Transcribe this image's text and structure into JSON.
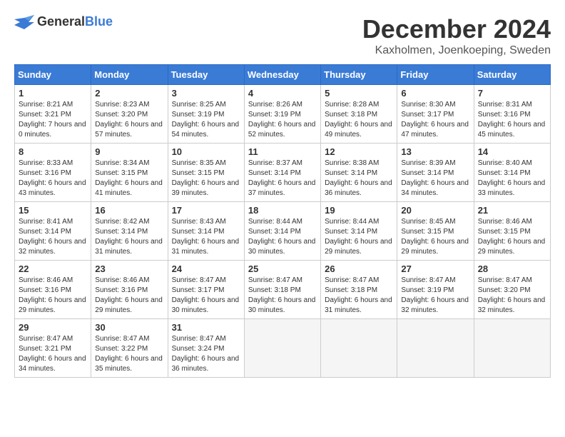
{
  "header": {
    "logo_general": "General",
    "logo_blue": "Blue",
    "title": "December 2024",
    "location": "Kaxholmen, Joenkoeping, Sweden"
  },
  "days_of_week": [
    "Sunday",
    "Monday",
    "Tuesday",
    "Wednesday",
    "Thursday",
    "Friday",
    "Saturday"
  ],
  "weeks": [
    [
      {
        "day": "1",
        "sunrise": "Sunrise: 8:21 AM",
        "sunset": "Sunset: 3:21 PM",
        "daylight": "Daylight: 7 hours and 0 minutes."
      },
      {
        "day": "2",
        "sunrise": "Sunrise: 8:23 AM",
        "sunset": "Sunset: 3:20 PM",
        "daylight": "Daylight: 6 hours and 57 minutes."
      },
      {
        "day": "3",
        "sunrise": "Sunrise: 8:25 AM",
        "sunset": "Sunset: 3:19 PM",
        "daylight": "Daylight: 6 hours and 54 minutes."
      },
      {
        "day": "4",
        "sunrise": "Sunrise: 8:26 AM",
        "sunset": "Sunset: 3:19 PM",
        "daylight": "Daylight: 6 hours and 52 minutes."
      },
      {
        "day": "5",
        "sunrise": "Sunrise: 8:28 AM",
        "sunset": "Sunset: 3:18 PM",
        "daylight": "Daylight: 6 hours and 49 minutes."
      },
      {
        "day": "6",
        "sunrise": "Sunrise: 8:30 AM",
        "sunset": "Sunset: 3:17 PM",
        "daylight": "Daylight: 6 hours and 47 minutes."
      },
      {
        "day": "7",
        "sunrise": "Sunrise: 8:31 AM",
        "sunset": "Sunset: 3:16 PM",
        "daylight": "Daylight: 6 hours and 45 minutes."
      }
    ],
    [
      {
        "day": "8",
        "sunrise": "Sunrise: 8:33 AM",
        "sunset": "Sunset: 3:16 PM",
        "daylight": "Daylight: 6 hours and 43 minutes."
      },
      {
        "day": "9",
        "sunrise": "Sunrise: 8:34 AM",
        "sunset": "Sunset: 3:15 PM",
        "daylight": "Daylight: 6 hours and 41 minutes."
      },
      {
        "day": "10",
        "sunrise": "Sunrise: 8:35 AM",
        "sunset": "Sunset: 3:15 PM",
        "daylight": "Daylight: 6 hours and 39 minutes."
      },
      {
        "day": "11",
        "sunrise": "Sunrise: 8:37 AM",
        "sunset": "Sunset: 3:14 PM",
        "daylight": "Daylight: 6 hours and 37 minutes."
      },
      {
        "day": "12",
        "sunrise": "Sunrise: 8:38 AM",
        "sunset": "Sunset: 3:14 PM",
        "daylight": "Daylight: 6 hours and 36 minutes."
      },
      {
        "day": "13",
        "sunrise": "Sunrise: 8:39 AM",
        "sunset": "Sunset: 3:14 PM",
        "daylight": "Daylight: 6 hours and 34 minutes."
      },
      {
        "day": "14",
        "sunrise": "Sunrise: 8:40 AM",
        "sunset": "Sunset: 3:14 PM",
        "daylight": "Daylight: 6 hours and 33 minutes."
      }
    ],
    [
      {
        "day": "15",
        "sunrise": "Sunrise: 8:41 AM",
        "sunset": "Sunset: 3:14 PM",
        "daylight": "Daylight: 6 hours and 32 minutes."
      },
      {
        "day": "16",
        "sunrise": "Sunrise: 8:42 AM",
        "sunset": "Sunset: 3:14 PM",
        "daylight": "Daylight: 6 hours and 31 minutes."
      },
      {
        "day": "17",
        "sunrise": "Sunrise: 8:43 AM",
        "sunset": "Sunset: 3:14 PM",
        "daylight": "Daylight: 6 hours and 31 minutes."
      },
      {
        "day": "18",
        "sunrise": "Sunrise: 8:44 AM",
        "sunset": "Sunset: 3:14 PM",
        "daylight": "Daylight: 6 hours and 30 minutes."
      },
      {
        "day": "19",
        "sunrise": "Sunrise: 8:44 AM",
        "sunset": "Sunset: 3:14 PM",
        "daylight": "Daylight: 6 hours and 29 minutes."
      },
      {
        "day": "20",
        "sunrise": "Sunrise: 8:45 AM",
        "sunset": "Sunset: 3:15 PM",
        "daylight": "Daylight: 6 hours and 29 minutes."
      },
      {
        "day": "21",
        "sunrise": "Sunrise: 8:46 AM",
        "sunset": "Sunset: 3:15 PM",
        "daylight": "Daylight: 6 hours and 29 minutes."
      }
    ],
    [
      {
        "day": "22",
        "sunrise": "Sunrise: 8:46 AM",
        "sunset": "Sunset: 3:16 PM",
        "daylight": "Daylight: 6 hours and 29 minutes."
      },
      {
        "day": "23",
        "sunrise": "Sunrise: 8:46 AM",
        "sunset": "Sunset: 3:16 PM",
        "daylight": "Daylight: 6 hours and 29 minutes."
      },
      {
        "day": "24",
        "sunrise": "Sunrise: 8:47 AM",
        "sunset": "Sunset: 3:17 PM",
        "daylight": "Daylight: 6 hours and 30 minutes."
      },
      {
        "day": "25",
        "sunrise": "Sunrise: 8:47 AM",
        "sunset": "Sunset: 3:18 PM",
        "daylight": "Daylight: 6 hours and 30 minutes."
      },
      {
        "day": "26",
        "sunrise": "Sunrise: 8:47 AM",
        "sunset": "Sunset: 3:18 PM",
        "daylight": "Daylight: 6 hours and 31 minutes."
      },
      {
        "day": "27",
        "sunrise": "Sunrise: 8:47 AM",
        "sunset": "Sunset: 3:19 PM",
        "daylight": "Daylight: 6 hours and 32 minutes."
      },
      {
        "day": "28",
        "sunrise": "Sunrise: 8:47 AM",
        "sunset": "Sunset: 3:20 PM",
        "daylight": "Daylight: 6 hours and 32 minutes."
      }
    ],
    [
      {
        "day": "29",
        "sunrise": "Sunrise: 8:47 AM",
        "sunset": "Sunset: 3:21 PM",
        "daylight": "Daylight: 6 hours and 34 minutes."
      },
      {
        "day": "30",
        "sunrise": "Sunrise: 8:47 AM",
        "sunset": "Sunset: 3:22 PM",
        "daylight": "Daylight: 6 hours and 35 minutes."
      },
      {
        "day": "31",
        "sunrise": "Sunrise: 8:47 AM",
        "sunset": "Sunset: 3:24 PM",
        "daylight": "Daylight: 6 hours and 36 minutes."
      },
      null,
      null,
      null,
      null
    ]
  ]
}
